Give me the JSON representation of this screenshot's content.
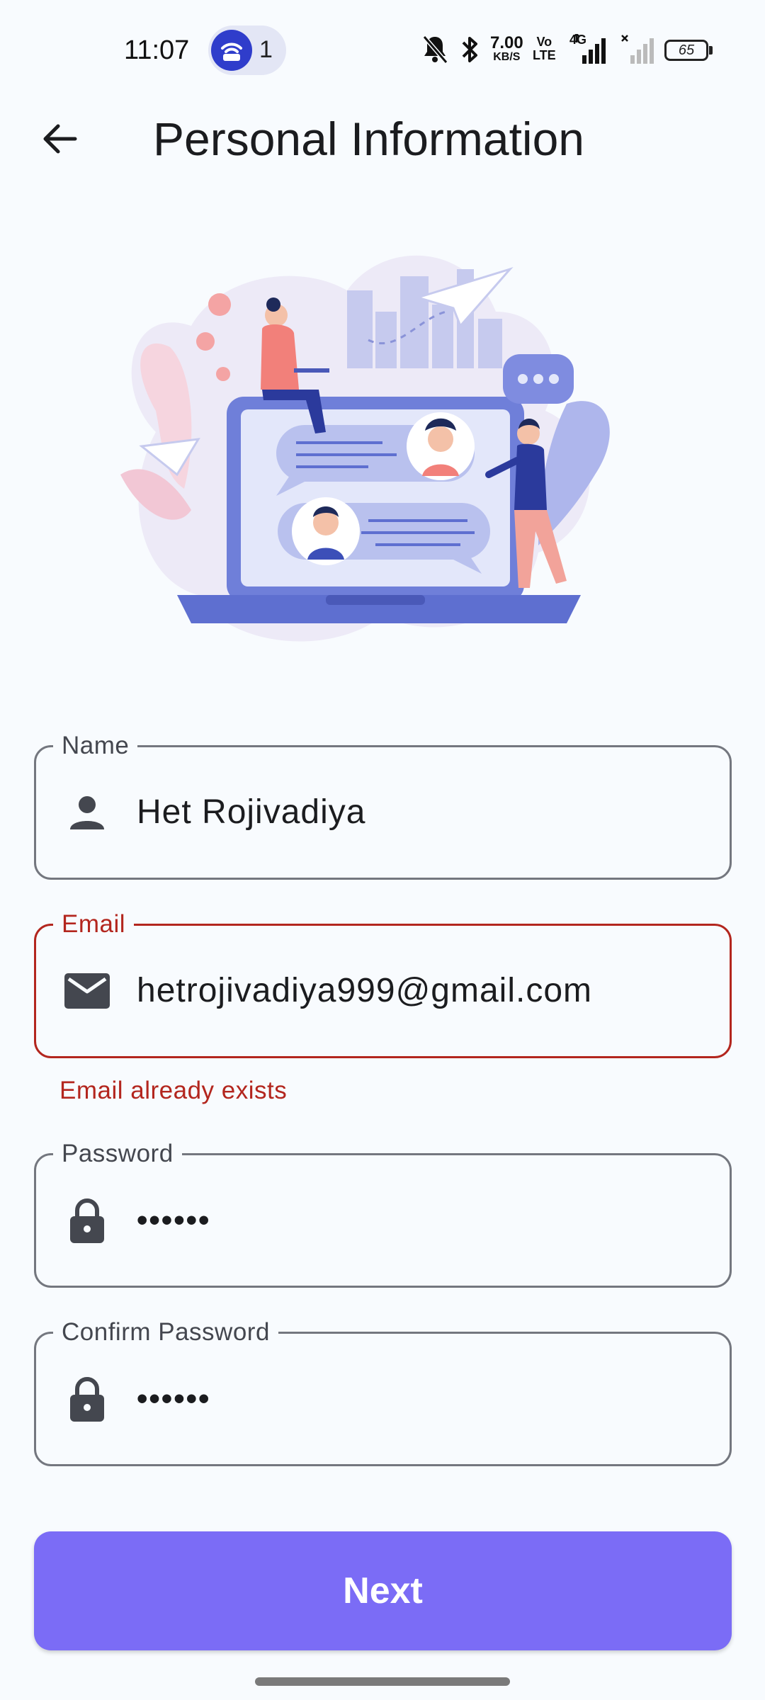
{
  "status_bar": {
    "time": "11:07",
    "hotspot_count": "1",
    "net_speed_value": "7.00",
    "net_speed_unit": "KB/S",
    "volte_top": "Vo",
    "volte_bottom": "LTE",
    "network_type": "4G",
    "battery": "65"
  },
  "app_bar": {
    "title": "Personal Information"
  },
  "form": {
    "name": {
      "label": "Name",
      "value": "Het Rojivadiya"
    },
    "email": {
      "label": "Email",
      "value": "hetrojivadiya999@gmail.com",
      "error": "Email already exists"
    },
    "password": {
      "label": "Password",
      "value": "••••••"
    },
    "confirm_password": {
      "label": "Confirm Password",
      "value": "••••••"
    }
  },
  "next_button": {
    "label": "Next"
  },
  "colors": {
    "accent": "#7B6CF6",
    "error": "#B3261E",
    "outline": "#74777F",
    "background": "#F8FBFE"
  }
}
